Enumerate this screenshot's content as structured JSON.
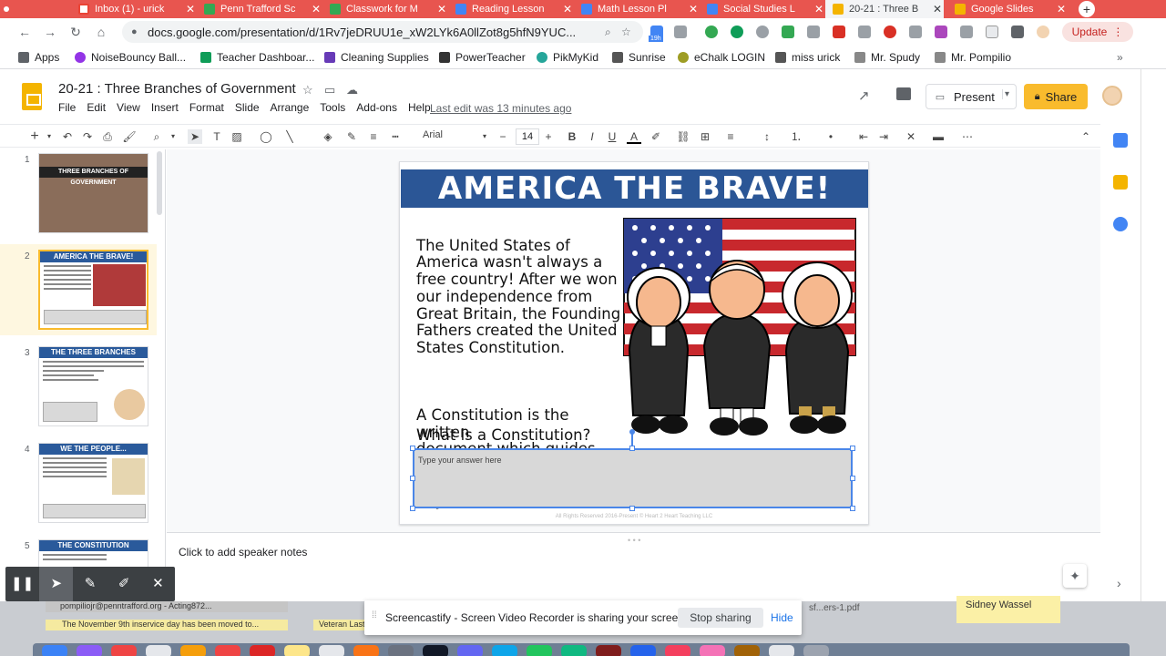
{
  "browser": {
    "tabs": [
      {
        "title": "Inbox (1) - urick",
        "color": "#ea4335"
      },
      {
        "title": "Penn Trafford Sc",
        "color": "#34a853"
      },
      {
        "title": "Classwork for M",
        "color": "#34a853"
      },
      {
        "title": "Reading Lesson",
        "color": "#4285f4"
      },
      {
        "title": "Math Lesson Pl",
        "color": "#4285f4"
      },
      {
        "title": "Social Studies L",
        "color": "#4285f4"
      },
      {
        "title": "20-21 : Three B",
        "color": "#f4b400"
      },
      {
        "title": "Google Slides",
        "color": "#f4b400"
      }
    ],
    "url": "docs.google.com/presentation/d/1Rv7jeDRUU1e_xW2LYk6A0llZot8g5hfN9YUC...",
    "update_label": "Update",
    "ext_badge": "19h"
  },
  "bookmarks": [
    {
      "label": "Apps",
      "color": "#5f6368"
    },
    {
      "label": "NoiseBouncy Ball...",
      "color": "#9334e6"
    },
    {
      "label": "Teacher Dashboar...",
      "color": "#0f9d58"
    },
    {
      "label": "Cleaning Supplies",
      "color": "#673ab7"
    },
    {
      "label": "PowerTeacher",
      "color": "#333333"
    },
    {
      "label": "PikMyKid",
      "color": "#26a69a"
    },
    {
      "label": "Sunrise",
      "color": "#555555"
    },
    {
      "label": "eChalk LOGIN",
      "color": "#9e9d24"
    },
    {
      "label": "miss urick",
      "color": "#555555"
    },
    {
      "label": "Mr. Spudy",
      "color": "#888888"
    },
    {
      "label": "Mr. Pompilio",
      "color": "#888888"
    }
  ],
  "slides_app": {
    "doc_title": "20-21 : Three Branches of Government",
    "menu": [
      "File",
      "Edit",
      "View",
      "Insert",
      "Format",
      "Slide",
      "Arrange",
      "Tools",
      "Add-ons",
      "Help"
    ],
    "last_edit": "Last edit was 13 minutes ago",
    "present_label": "Present",
    "share_label": "Share",
    "toolbar": {
      "font": "Arial",
      "font_size": "14"
    },
    "speaker_notes": "Click to add speaker notes"
  },
  "filmstrip": [
    {
      "num": "1",
      "title": "THREE BRANCHES OF GOVERNMENT"
    },
    {
      "num": "2",
      "title": "AMERICA THE BRAVE!"
    },
    {
      "num": "3",
      "title": "THE THREE BRANCHES"
    },
    {
      "num": "4",
      "title": "WE THE PEOPLE..."
    },
    {
      "num": "5",
      "title": "THE CONSTITUTION"
    }
  ],
  "slide": {
    "banner": "AMERICA THE BRAVE!",
    "paragraph1": "The United States of\nAmerica wasn't always a\nfree country! After we won\nour independence from\nGreat Britain, the Founding\nFathers created the United\nStates Constitution.",
    "paragraph2": "A Constitution is the written\ndocument which guides our\ngovernment still to this day.",
    "question": "What is a Constitution?",
    "answer_placeholder": "Type your answer here",
    "copyright": "All Rights Reserved 2016-Present © Heart 2 Heart Teaching LLC"
  },
  "screencastify": {
    "message": "Screencastify - Screen Video Recorder is sharing your screen.",
    "stop_label": "Stop sharing",
    "hide_label": "Hide"
  },
  "desktop": {
    "note1": "pompiliojr@penntrafford.org - Acting872...",
    "note2": "The November 9th inservice day has been moved to...",
    "note3": "Veteran Last F",
    "sticky": "Sidney Wassel",
    "file": "sf...ers-1.pdf"
  }
}
